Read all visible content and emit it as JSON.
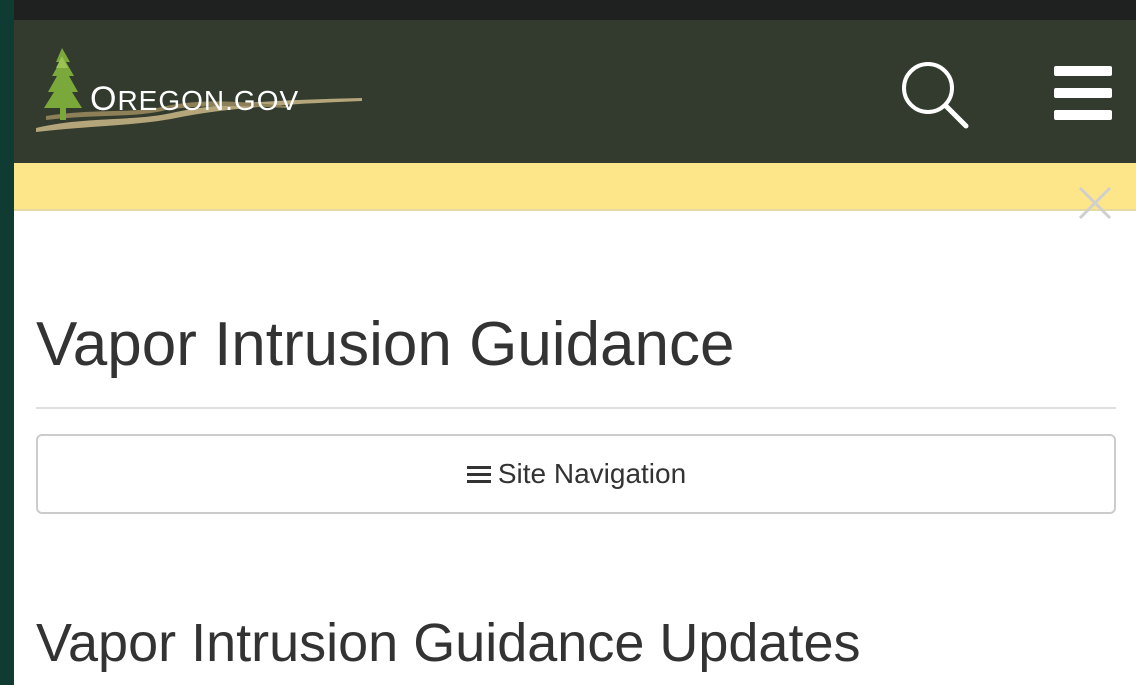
{
  "header": {
    "logo_text": "Oregon.gov",
    "search_label": "search-icon",
    "menu_label": "menu-icon",
    "colors": {
      "background": "#333b2e",
      "logo_tree": "#7ba83a",
      "logo_river": "#b5a57a"
    }
  },
  "alert": {
    "background": "#fde58a",
    "close_icon": "close-icon"
  },
  "main": {
    "page_title": "Vapor Intrusion Guidance",
    "site_nav_label": "Site Navigation",
    "site_nav_icon": "hamburger-icon",
    "section_heading": "Vapor Intrusion Guidance Updates"
  }
}
